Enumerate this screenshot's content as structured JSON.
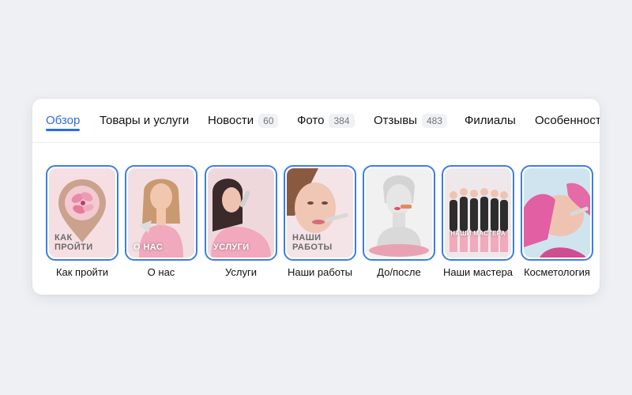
{
  "tabs": [
    {
      "label": "Обзор",
      "active": true
    },
    {
      "label": "Товары и услуги"
    },
    {
      "label": "Новости",
      "count": "60"
    },
    {
      "label": "Фото",
      "count": "384"
    },
    {
      "label": "Отзывы",
      "count": "483"
    },
    {
      "label": "Филиалы"
    },
    {
      "label": "Особенност"
    }
  ],
  "stories": [
    {
      "label": "Как пройти",
      "overlay": "КАК ПРОЙТИ",
      "icon": "map-pin-flower-icon"
    },
    {
      "label": "О нас",
      "overlay": "О НАС"
    },
    {
      "label": "Услуги",
      "overlay": "УСЛУГИ"
    },
    {
      "label": "Наши работы",
      "overlay": "НАШИ РАБОТЫ"
    },
    {
      "label": "До/после"
    },
    {
      "label": "Наши мастера",
      "overlay": "НАШИ МАСТЕРА"
    },
    {
      "label": "Косметология"
    }
  ],
  "colors": {
    "accent": "#2b6de2",
    "story_border": "#3b7ee8"
  }
}
